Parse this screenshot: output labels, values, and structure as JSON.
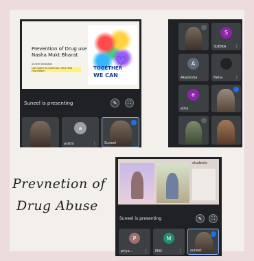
{
  "collage_title": {
    "line1": "Prevnetion of",
    "line2": "Drug Abuse"
  },
  "screen1": {
    "slide": {
      "title_line1": "Prevention of Drug use",
      "title_line2": "Nasha Mukt Bharat",
      "presenter_name": "Suneel Sebastian",
      "presenter_role": "Life Coach & Chairman, Nest Hilla Foundation",
      "logo_line1": "TOGETHER",
      "logo_line2": "WE CAN"
    },
    "presenting": "Suneel is presenting",
    "participants": [
      {
        "name": "",
        "initial": ""
      },
      {
        "name": "arathi",
        "initial": "a"
      },
      {
        "name": "Suneel",
        "initial": ""
      }
    ]
  },
  "screen2": {
    "participants": [
      {
        "name": "",
        "initial": ""
      },
      {
        "name": "SUBIKA",
        "initial": "S"
      },
      {
        "name": "Akanksha",
        "initial": "A"
      },
      {
        "name": "Neha",
        "initial": ""
      },
      {
        "name": "ethe",
        "initial": "e"
      },
      {
        "name": "",
        "initial": ""
      },
      {
        "name": "",
        "initial": ""
      },
      {
        "name": "",
        "initial": ""
      }
    ]
  },
  "screen3": {
    "slide_caption": "students",
    "presenting": "Suneel is presenting",
    "participants": [
      {
        "name": "priya...",
        "initial": "P"
      },
      {
        "name": "Milli",
        "initial": "M"
      },
      {
        "name": "suneel",
        "initial": ""
      }
    ]
  },
  "colors": {
    "meet_bg": "#1f2125",
    "tile_bg": "#3c4043",
    "accent_blue": "#1a73e8",
    "avatar_purple": "#8e24aa",
    "avatar_teal": "#1e8e73"
  }
}
